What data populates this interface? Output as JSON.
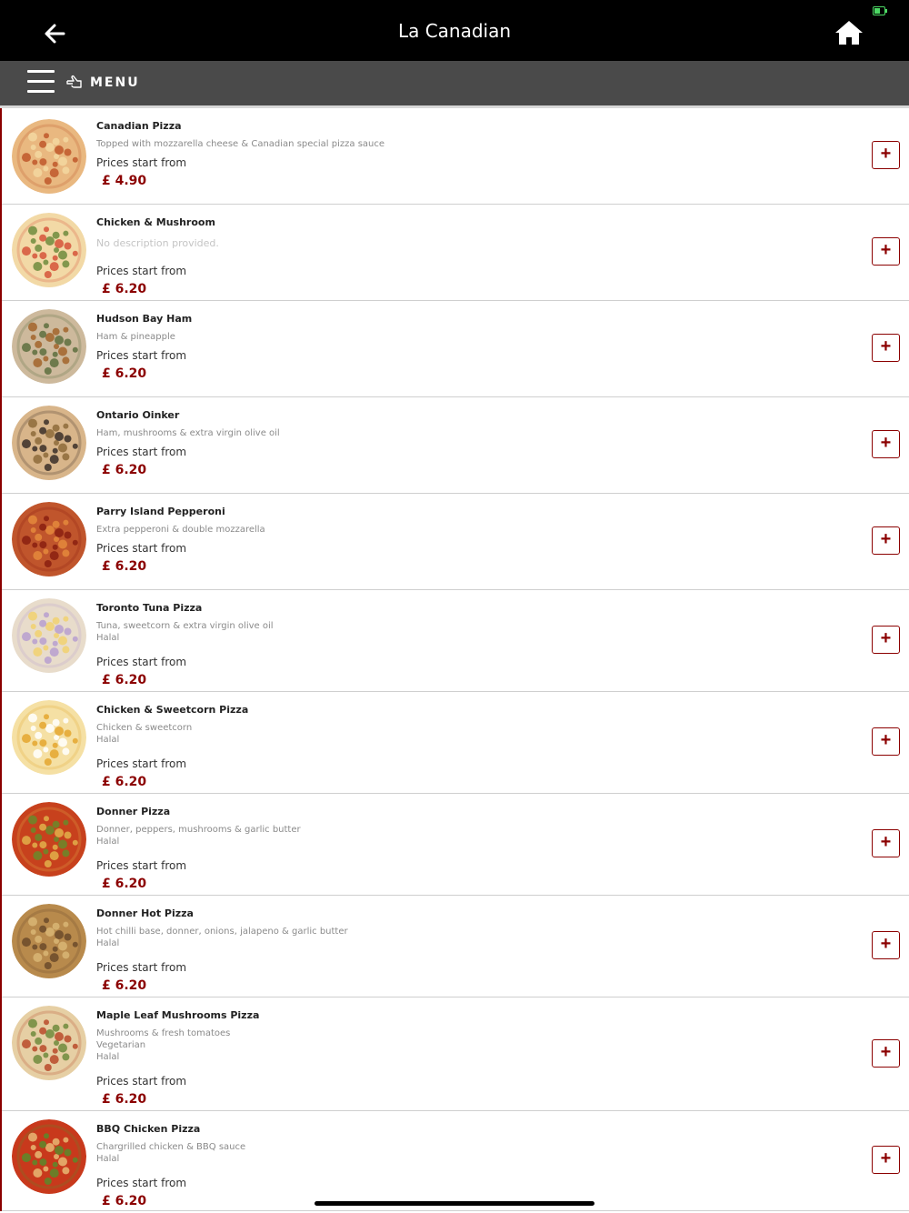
{
  "header": {
    "title": "La Canadian",
    "back_icon": "back-arrow-icon",
    "home_icon": "home-icon"
  },
  "menubar": {
    "label": "MENU",
    "icon": "pointing-hand-icon"
  },
  "colors": {
    "accent": "#8b0000",
    "header_bg": "#000000",
    "menubar_bg": "#4a4a4a"
  },
  "items": [
    {
      "name": "Canadian Pizza",
      "desc": [
        "Topped with mozzarella cheese & Canadian special pizza sauce"
      ],
      "prices_label": "Prices start from",
      "price": "£ 4.90"
    },
    {
      "name": "Chicken & Mushroom",
      "desc": [
        "No description provided."
      ],
      "prices_label": "Prices start from",
      "price": "£ 6.20"
    },
    {
      "name": "Hudson Bay Ham",
      "desc": [
        "Ham & pineapple"
      ],
      "prices_label": "Prices start from",
      "price": "£ 6.20"
    },
    {
      "name": "Ontario Oinker",
      "desc": [
        "Ham, mushrooms & extra virgin olive oil"
      ],
      "prices_label": "Prices start from",
      "price": "£ 6.20"
    },
    {
      "name": "Parry Island Pepperoni",
      "desc": [
        "Extra pepperoni & double mozzarella"
      ],
      "prices_label": "Prices start from",
      "price": "£ 6.20"
    },
    {
      "name": "Toronto Tuna Pizza",
      "desc": [
        "Tuna, sweetcorn & extra virgin olive oil",
        "Halal"
      ],
      "prices_label": "Prices start from",
      "price": "£ 6.20"
    },
    {
      "name": "Chicken & Sweetcorn Pizza",
      "desc": [
        "Chicken & sweetcorn",
        "Halal"
      ],
      "prices_label": "Prices start from",
      "price": "£ 6.20"
    },
    {
      "name": "Donner Pizza",
      "desc": [
        "Donner, peppers, mushrooms & garlic butter",
        "Halal"
      ],
      "prices_label": "Prices start from",
      "price": "£ 6.20"
    },
    {
      "name": "Donner Hot Pizza",
      "desc": [
        "Hot chilli base, donner, onions, jalapeno & garlic butter",
        "Halal"
      ],
      "prices_label": "Prices start from",
      "price": "£ 6.20"
    },
    {
      "name": "Maple Leaf Mushrooms Pizza",
      "desc": [
        "Mushrooms & fresh tomatoes",
        "Vegetarian",
        "Halal"
      ],
      "prices_label": "Prices start from",
      "price": "£ 6.20"
    },
    {
      "name": "BBQ Chicken Pizza",
      "desc": [
        "Chargrilled chicken & BBQ sauce",
        "Halal"
      ],
      "prices_label": "Prices start from",
      "price": "£ 6.20"
    }
  ],
  "add_label": "+"
}
